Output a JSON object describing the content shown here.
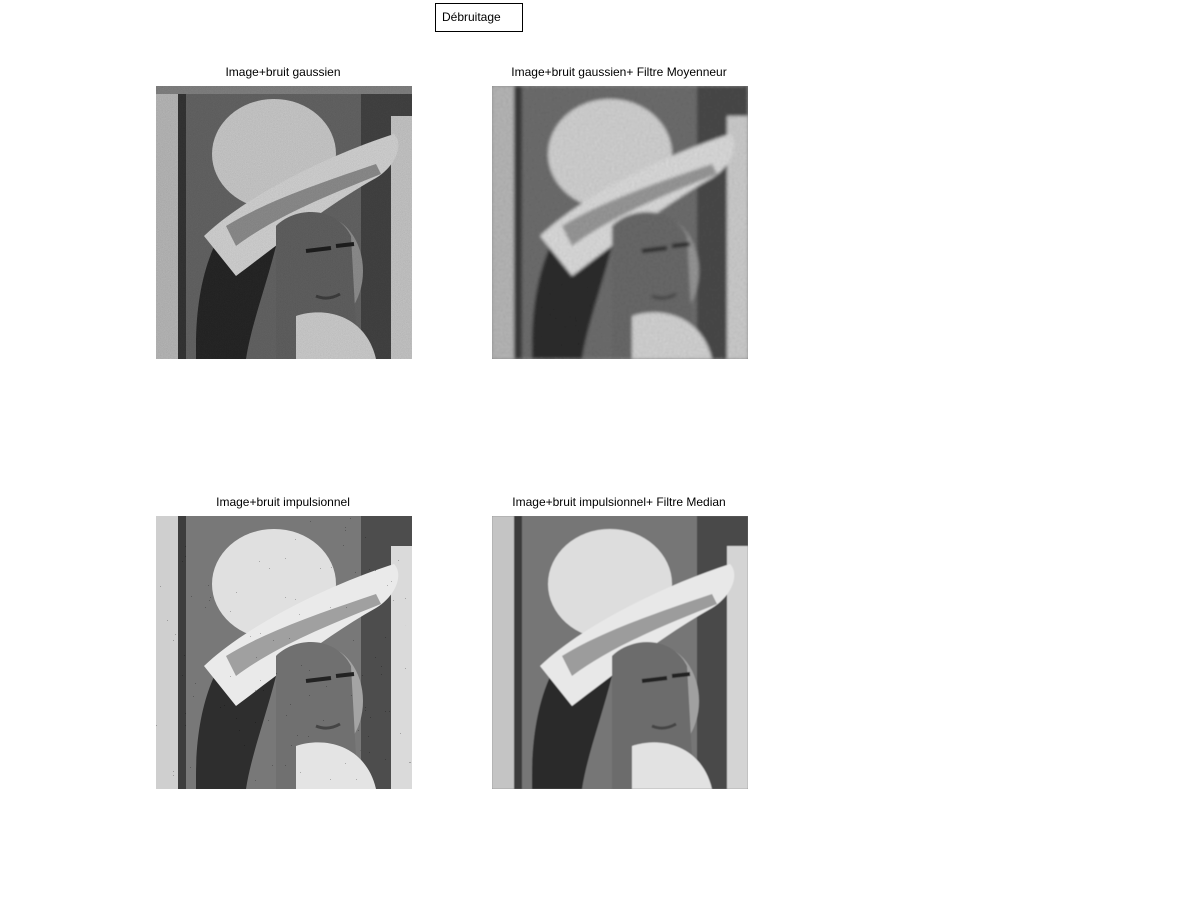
{
  "toolbar": {
    "button_label": "Débruitage"
  },
  "panels": [
    {
      "title": "Image+bruit gaussien",
      "noise": "gaussian"
    },
    {
      "title": "Image+bruit gaussien+ Filtre Moyenneur",
      "noise": "smoothed"
    },
    {
      "title": "Image+bruit impulsionnel",
      "noise": "impulse"
    },
    {
      "title": "Image+bruit impulsionnel+ Filtre Median",
      "noise": "median"
    }
  ]
}
